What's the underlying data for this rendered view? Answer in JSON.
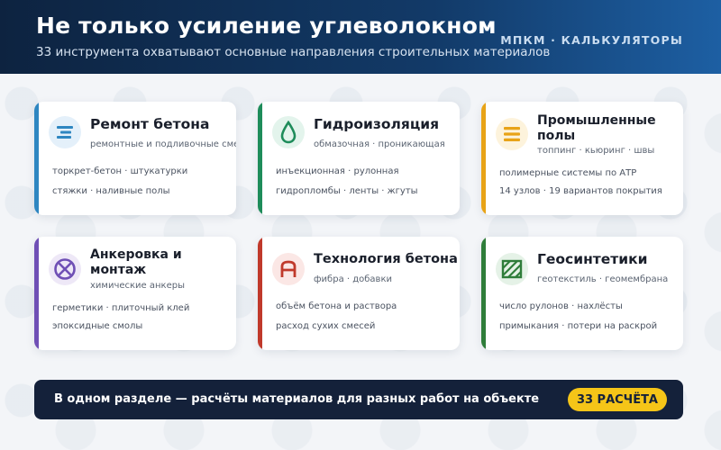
{
  "header": {
    "title": "Не только усиление углеволокном",
    "subtitle": "33 инструмента охватывают основные направления строительных материалов",
    "brand": "МПКМ · КАЛЬКУЛЯТОРЫ"
  },
  "cards": [
    {
      "title": "Ремонт бетона",
      "subtitle": "ремонтные и подливочные смеси",
      "line1": "торкрет-бетон · штукатурки",
      "line2": "стяжки · наливные полы",
      "accent": "#2e86c1",
      "icon": "lines-icon"
    },
    {
      "title": "Гидроизоляция",
      "subtitle": "обмазочная · проникающая",
      "line1": "инъекционная · рулонная",
      "line2": "гидропломбы · ленты · жгуты",
      "accent": "#1e8c5a",
      "icon": "water-drop-icon"
    },
    {
      "title": "Промышленные полы",
      "subtitle": "топпинг · кьюринг · швы",
      "line1": "полимерные системы по АТР",
      "line2": "14 узлов · 19 вариантов покрытия",
      "accent": "#e8a317",
      "icon": "layers-icon"
    },
    {
      "title": "Анкеровка и монтаж",
      "subtitle": "химические анкеры",
      "line1": "герметики · плиточный клей",
      "line2": "эпоксидные смолы",
      "accent": "#6f4fb5",
      "icon": "anchor-cross-icon"
    },
    {
      "title": "Технология бетона",
      "subtitle": "фибра · добавки",
      "line1": "объём бетона и раствора",
      "line2": "расход сухих смесей",
      "accent": "#c0392b",
      "icon": "letter-a-icon"
    },
    {
      "title": "Геосинтетики",
      "subtitle": "геотекстиль · геомембрана",
      "line1": "число рулонов · нахлёсты",
      "line2": "примыкания · потери на раскрой",
      "accent": "#2f7d3a",
      "icon": "hatched-square-icon"
    }
  ],
  "bottom": {
    "text": "В одном разделе — расчёты материалов для разных работ на объекте",
    "badge": "33 РАСЧЁТА"
  }
}
